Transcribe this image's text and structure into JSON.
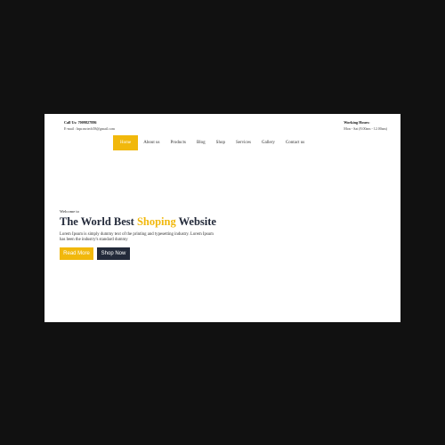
{
  "topbar": {
    "call_label": "Call Us: 7009827886",
    "email_label": "E-mail : lnpr.mrtech58@gmail.com",
    "hours_title": "Working Hours:",
    "hours_value": "Mon - Sat (8.00am - 12.00am)"
  },
  "nav": {
    "items": [
      {
        "label": "Home"
      },
      {
        "label": "About us"
      },
      {
        "label": "Products"
      },
      {
        "label": "Blog"
      },
      {
        "label": "Shop"
      },
      {
        "label": "Services"
      },
      {
        "label": "Gallery"
      },
      {
        "label": "Contact us"
      }
    ],
    "active_index": 0
  },
  "hero": {
    "welcome": "Welcome to",
    "title_part1": "The World Best ",
    "title_accent": "Shoping",
    "title_part2": " Website",
    "description": "Lorem Ipsum is simply dummy text of the printing and typesetting industry. Lorem Ipsum has been the industry's standard dummy",
    "read_more_label": "Read More",
    "shop_now_label": "Shop Now"
  },
  "colors": {
    "accent": "#f1b80c",
    "dark": "#232a3a",
    "backdrop": "#111111"
  }
}
